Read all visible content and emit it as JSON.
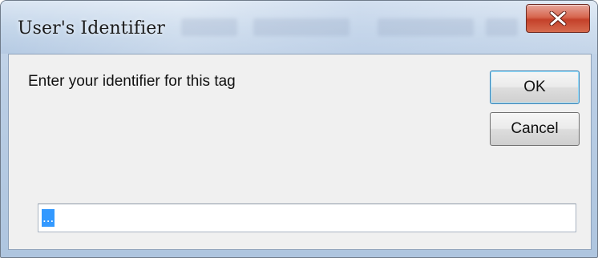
{
  "window": {
    "title": "User's Identifier",
    "close_glyph": "x",
    "close_icon": "close-icon"
  },
  "dialog": {
    "prompt": "Enter your identifier for this tag",
    "ok_label": "OK",
    "cancel_label": "Cancel",
    "identifier_value": "..."
  },
  "colors": {
    "close_button": "#c4412a",
    "selection": "#3399ff",
    "dialog_background": "#f0f0f0"
  }
}
